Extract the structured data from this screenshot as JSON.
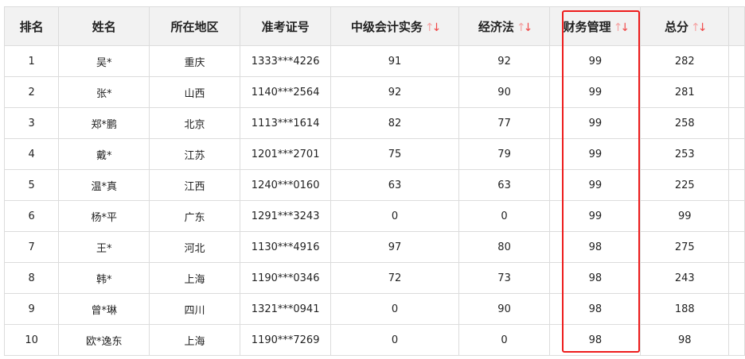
{
  "columns": [
    {
      "label": "排名",
      "sortable": false
    },
    {
      "label": "姓名",
      "sortable": false
    },
    {
      "label": "所在地区",
      "sortable": false
    },
    {
      "label": "准考证号",
      "sortable": false
    },
    {
      "label": "中级会计实务",
      "sortable": true
    },
    {
      "label": "经济法",
      "sortable": true
    },
    {
      "label": "财务管理",
      "sortable": true
    },
    {
      "label": "总分",
      "sortable": true
    }
  ],
  "sort_icon": {
    "up": "↑",
    "down": "↓"
  },
  "highlight_color": "#ee1c1c",
  "rows": [
    [
      "1",
      "吴*",
      "重庆",
      "1333***4226",
      "91",
      "92",
      "99",
      "282"
    ],
    [
      "2",
      "张*",
      "山西",
      "1140***2564",
      "92",
      "90",
      "99",
      "281"
    ],
    [
      "3",
      "郑*鹏",
      "北京",
      "1113***1614",
      "82",
      "77",
      "99",
      "258"
    ],
    [
      "4",
      "戴*",
      "江苏",
      "1201***2701",
      "75",
      "79",
      "99",
      "253"
    ],
    [
      "5",
      "温*真",
      "江西",
      "1240***0160",
      "63",
      "63",
      "99",
      "225"
    ],
    [
      "6",
      "杨*平",
      "广东",
      "1291***3243",
      "0",
      "0",
      "99",
      "99"
    ],
    [
      "7",
      "王*",
      "河北",
      "1130***4916",
      "97",
      "80",
      "98",
      "275"
    ],
    [
      "8",
      "韩*",
      "上海",
      "1190***0346",
      "72",
      "73",
      "98",
      "243"
    ],
    [
      "9",
      "曾*琳",
      "四川",
      "1321***0941",
      "0",
      "90",
      "98",
      "188"
    ],
    [
      "10",
      "欧*逸东",
      "上海",
      "1190***7269",
      "0",
      "0",
      "98",
      "98"
    ]
  ]
}
